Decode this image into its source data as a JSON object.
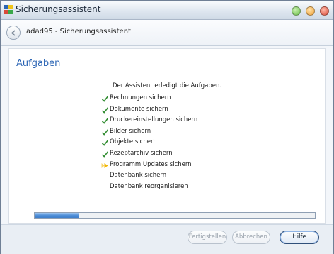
{
  "window": {
    "title": "Sicherungsassistent",
    "nav_title": "adad95 - Sicherungsassistent"
  },
  "page": {
    "title": "Aufgaben",
    "intro": "Der Assistent erledigt die Aufgaben."
  },
  "tasks": [
    {
      "label": "Rechnungen sichern",
      "status": "done"
    },
    {
      "label": "Dokumente sichern",
      "status": "done"
    },
    {
      "label": "Druckereinstellungen sichern",
      "status": "done"
    },
    {
      "label": "Bilder sichern",
      "status": "done"
    },
    {
      "label": "Objekte sichern",
      "status": "done"
    },
    {
      "label": "Rezeptarchiv sichern",
      "status": "done"
    },
    {
      "label": "Programm Updates sichern",
      "status": "current"
    },
    {
      "label": "Datenbank sichern",
      "status": "pending"
    },
    {
      "label": "Datenbank reorganisieren",
      "status": "pending"
    }
  ],
  "progress": {
    "fraction": 0.16
  },
  "buttons": {
    "finish": "Fertigstellen",
    "cancel": "Abbrechen",
    "help": "Hilfe"
  },
  "colors": {
    "accent": "#2a64b4",
    "check": "#2e8b2e",
    "current_arrow": "#f2b705",
    "close": "#d94b3a",
    "maximize": "#f0a23a",
    "minimize": "#6cc04a"
  }
}
